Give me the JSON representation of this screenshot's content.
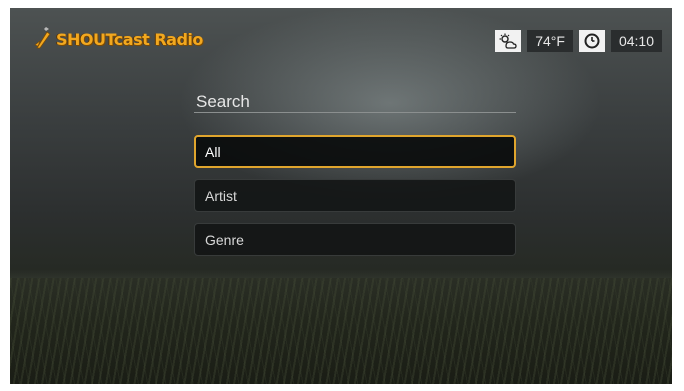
{
  "header": {
    "app_title": "SHOUTcast Radio",
    "weather_icon": "weather-icon",
    "temperature": "74°F",
    "clock_icon": "clock-icon",
    "time": "04:10"
  },
  "search": {
    "title": "Search",
    "items": [
      {
        "label": "All",
        "selected": true
      },
      {
        "label": "Artist",
        "selected": false
      },
      {
        "label": "Genre",
        "selected": false
      }
    ]
  },
  "colors": {
    "accent": "#e0a52d",
    "logo": "#f2a81f"
  }
}
